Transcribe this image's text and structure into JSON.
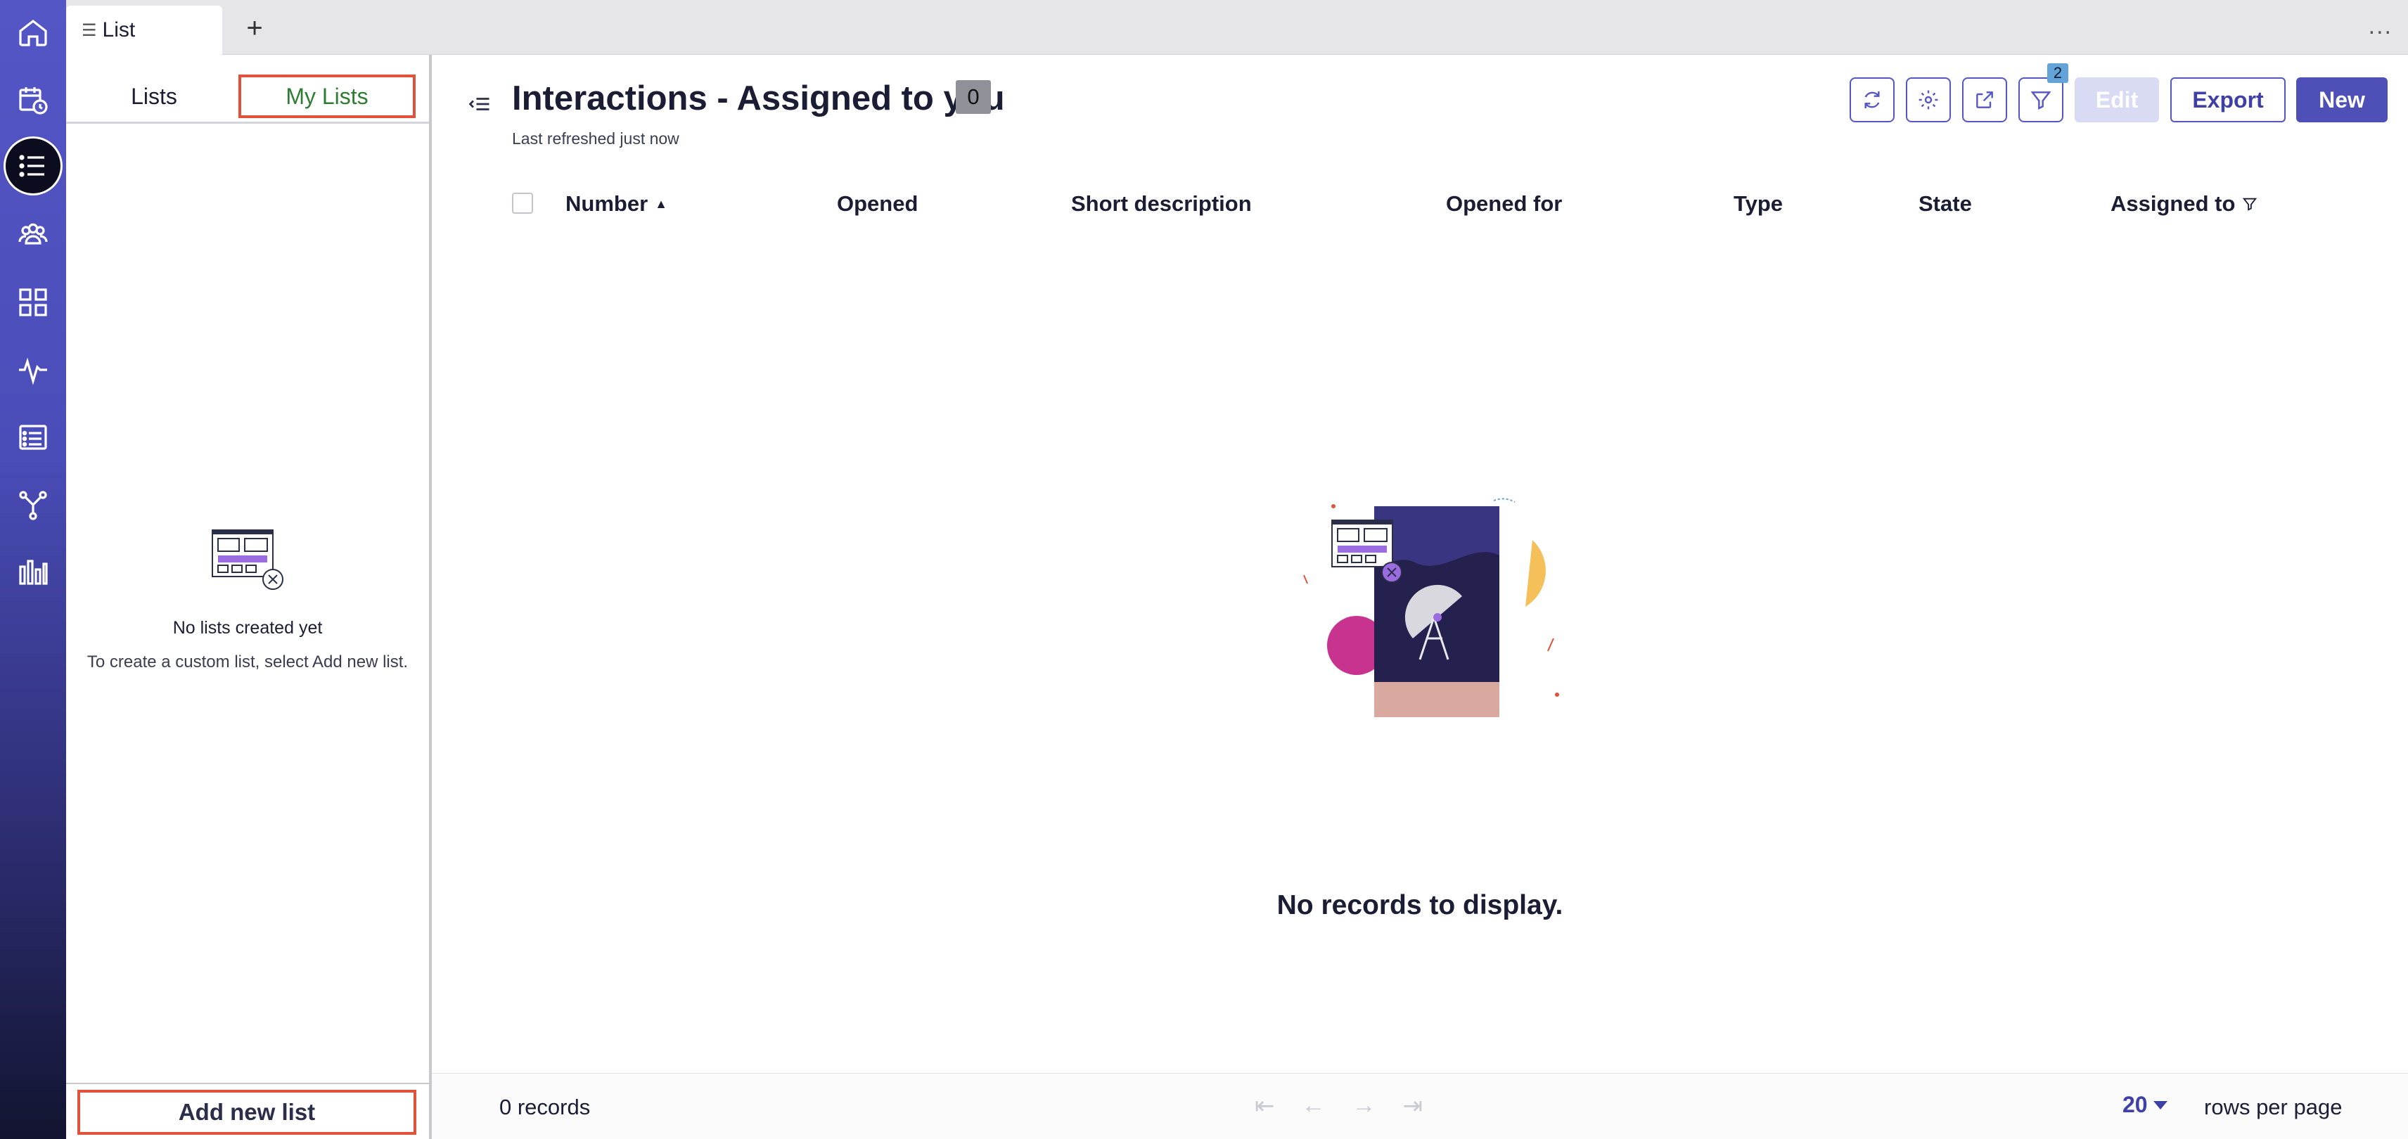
{
  "rail": {
    "items": [
      {
        "name": "home-icon"
      },
      {
        "name": "calendar-clock-icon"
      },
      {
        "name": "list-icon",
        "active": true
      },
      {
        "name": "users-group-icon"
      },
      {
        "name": "grid-icon"
      },
      {
        "name": "activity-pulse-icon"
      },
      {
        "name": "list-details-icon"
      },
      {
        "name": "fork-branch-icon"
      },
      {
        "name": "bar-chart-icon"
      }
    ]
  },
  "tabbar": {
    "active_tab": "List",
    "add_label": "+",
    "more_label": "..."
  },
  "lists_panel": {
    "tab_lists": "Lists",
    "tab_my_lists": "My Lists",
    "empty_title": "No lists created yet",
    "empty_desc": "To create a custom list, select Add new list.",
    "add_button": "Add new list"
  },
  "main": {
    "title": "Interactions - Assigned to you",
    "count": "0",
    "last_refreshed": "Last refreshed just now",
    "filter_count": "2",
    "edit_label": "Edit",
    "export_label": "Export",
    "new_label": "New",
    "columns": [
      "Number",
      "Opened",
      "Short description",
      "Opened for",
      "Type",
      "State",
      "Assigned to"
    ],
    "sort_indicator": "▲",
    "empty_message": "No records to display."
  },
  "footer": {
    "records": "0 records",
    "rows_per_page_value": "20",
    "rows_per_page_label": "rows per page",
    "pager": [
      "⇤",
      "←",
      "→",
      "⇥"
    ]
  },
  "colors": {
    "accent": "#5456c6",
    "highlight_border": "#e0533a",
    "my_lists_text": "#2e7d32"
  }
}
